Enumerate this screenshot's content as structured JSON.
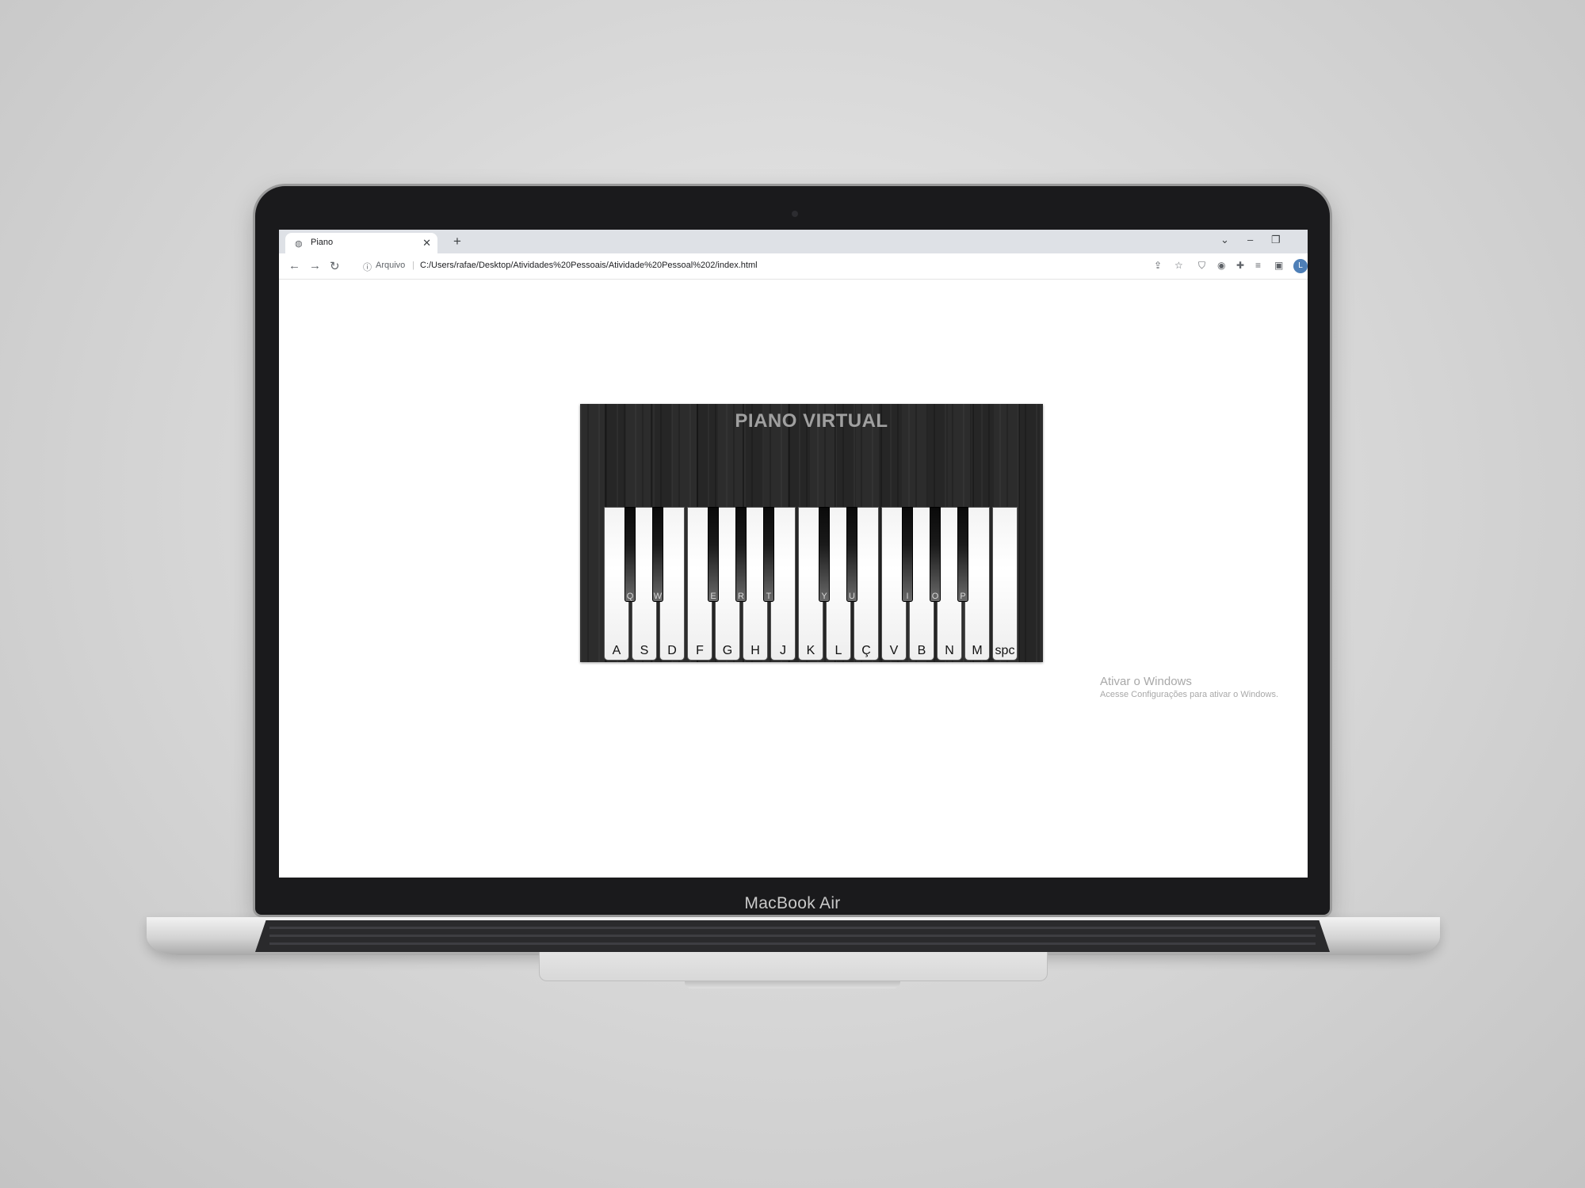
{
  "device": {
    "brand_label": "MacBook Air"
  },
  "browser": {
    "tab": {
      "title": "Piano",
      "favicon": "globe-icon",
      "close_glyph": "✕"
    },
    "new_tab_glyph": "+",
    "window_controls": {
      "list": "⌄",
      "minimize": "–",
      "restore": "❐"
    },
    "nav": {
      "back": "←",
      "forward": "→",
      "reload": "↻"
    },
    "address": {
      "info_glyph": "ⓘ",
      "scheme_label": "Arquivo",
      "separator": "|",
      "url": "C:/Users/rafae/Desktop/Atividades%20Pessoais/Atividade%20Pessoal%202/index.html"
    },
    "toolbar_icons": [
      "share-icon",
      "star-icon",
      "shield-icon",
      "extension-circle-icon",
      "puzzle-icon",
      "media-icon",
      "sidebar-icon"
    ],
    "profile_initial": "L"
  },
  "piano": {
    "title": "PIANO VIRTUAL",
    "white_keys": [
      "A",
      "S",
      "D",
      "F",
      "G",
      "H",
      "J",
      "K",
      "L",
      "Ç",
      "V",
      "B",
      "N",
      "M",
      "spc"
    ],
    "black_keys": [
      "Q",
      "W",
      "E",
      "R",
      "T",
      "Y",
      "U",
      "I",
      "O",
      "P"
    ]
  },
  "watermark": {
    "line1": "Ativar o Windows",
    "line2": "Acesse Configurações para ativar o Windows."
  }
}
